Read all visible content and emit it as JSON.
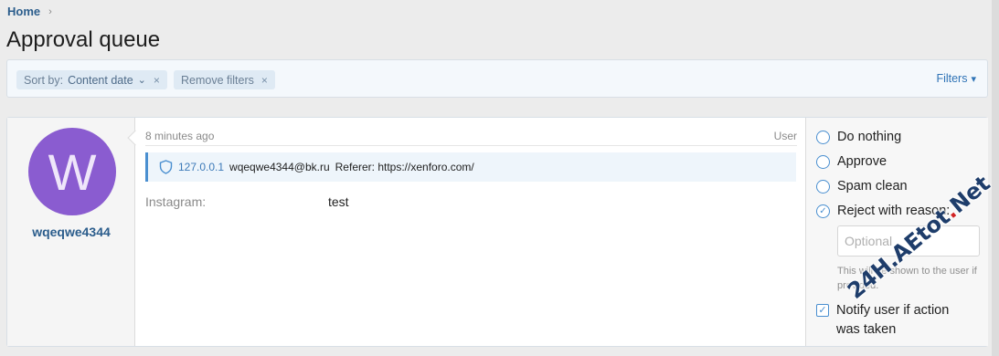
{
  "breadcrumb": {
    "home": "Home",
    "separator": "›"
  },
  "page": {
    "title": "Approval queue"
  },
  "filter_bar": {
    "sort_label": "Sort by:",
    "sort_value": "Content date",
    "sort_caret": "⌄",
    "remove_label": "Remove filters",
    "close_glyph": "×",
    "filters_label": "Filters",
    "filters_caret": "▾"
  },
  "item": {
    "avatar_letter": "W",
    "username": "wqeqwe4344",
    "time": "8 minutes ago",
    "content_type": "User",
    "ip": "127.0.0.1",
    "email": "wqeqwe4344@bk.ru",
    "referer": "Referer: https://xenforo.com/",
    "field_label": "Instagram:",
    "field_value": "test"
  },
  "actions": {
    "options": [
      "Do nothing",
      "Approve",
      "Spam clean",
      "Reject with reason:"
    ],
    "selected_index": 3,
    "reason_placeholder": "Optional",
    "reason_hint": "This will be shown to the user if provided.",
    "notify_label": "Notify user if action was taken",
    "notify_checked": true
  },
  "watermark": {
    "text_a": "24H.AEtot",
    "dot": ".",
    "text_b": "Net"
  },
  "colors": {
    "link": "#2b5d8c",
    "accent": "#4a8fd0",
    "avatar_bg": "#8a5cd0"
  }
}
